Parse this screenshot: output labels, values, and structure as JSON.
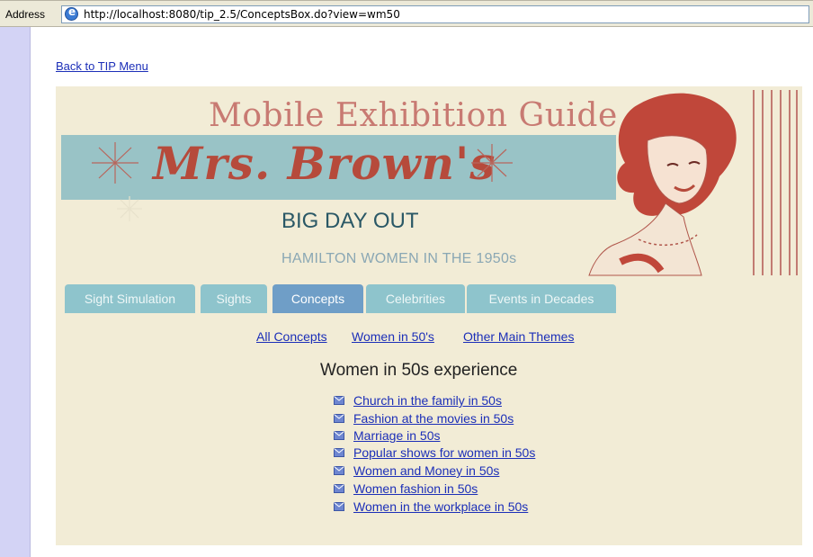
{
  "browser": {
    "address_label": "Address",
    "url": "http://localhost:8080/tip_2.5/ConceptsBox.do?view=wm50"
  },
  "back_link": "Back to TIP Menu",
  "banner": {
    "title_top": "Mobile Exhibition Guide",
    "title_main": "Mrs. Brown's",
    "subtitle": "BIG DAY OUT",
    "tagline": "HAMILTON WOMEN IN THE 1950s"
  },
  "tabs": [
    {
      "label": "Sight Simulation",
      "active": false
    },
    {
      "label": "Sights",
      "active": false
    },
    {
      "label": "Concepts",
      "active": true
    },
    {
      "label": "Celebrities",
      "active": false
    },
    {
      "label": "Events in Decades",
      "active": false
    }
  ],
  "subnav": [
    "All Concepts",
    "Women in 50's",
    "Other Main Themes"
  ],
  "section_heading": "Women in 50s experience",
  "concept_links": [
    "Church in the family in 50s",
    "Fashion at the movies in 50s",
    "Marriage in 50s",
    "Popular shows for women in 50s",
    "Women and Money in 50s",
    "Women fashion in 50s",
    "Women in the workplace in 50s"
  ],
  "colors": {
    "panel_bg": "#f2ecd6",
    "tab_bg": "#8ec4cc",
    "tab_active_bg": "#6f9ec7",
    "link": "#1c2fb8",
    "banner_bar": "#99c3c6",
    "title_red": "#b64a3b"
  }
}
